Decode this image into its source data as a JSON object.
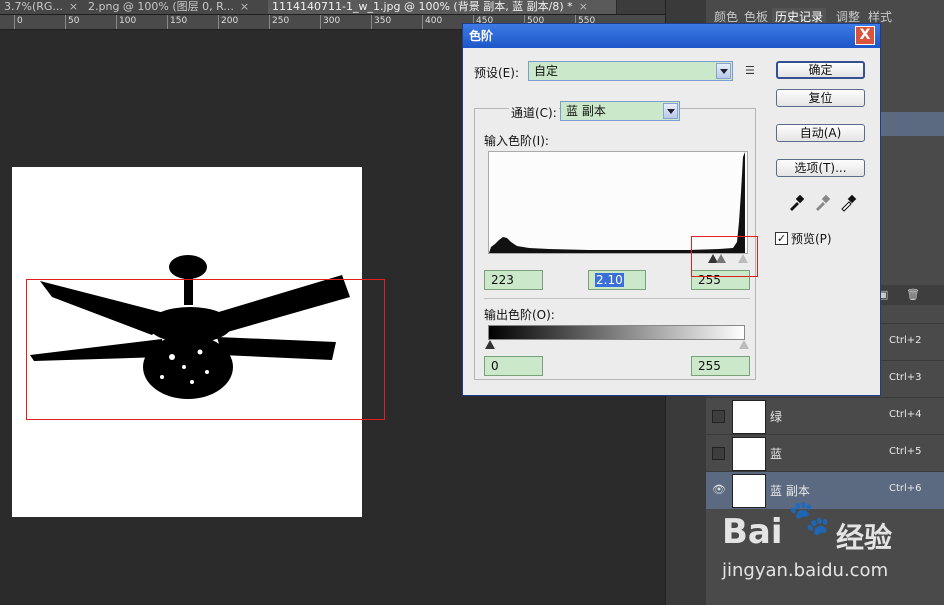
{
  "tabs": [
    {
      "label": "3.7%(RG..."
    },
    {
      "label": "2.png @ 100% (图层 0, R..."
    },
    {
      "label": "1114140711-1_w_1.jpg @ 100% (背景 副本, 蓝 副本/8) *"
    }
  ],
  "ruler": {
    "numbers": [
      "0",
      "50",
      "100",
      "150",
      "200",
      "250",
      "300",
      "350",
      "400",
      "450",
      "500",
      "550"
    ]
  },
  "right_panel": {
    "tabs": [
      "颜色",
      "色板",
      "历史记录",
      "调整",
      "样式"
    ],
    "layers": [
      {
        "name": "",
        "shortcut": "Ctrl+2"
      },
      {
        "name": "",
        "shortcut": "Ctrl+3"
      },
      {
        "name": "绿",
        "shortcut": "Ctrl+4"
      },
      {
        "name": "蓝",
        "shortcut": "Ctrl+5"
      },
      {
        "name": "蓝 副本",
        "shortcut": "Ctrl+6"
      }
    ]
  },
  "dialog": {
    "title": "色阶",
    "close_label": "X",
    "preset_label": "预设(E):",
    "preset_value": "自定",
    "channel_label": "通道(C):",
    "channel_value": "蓝 副本",
    "input_levels_label": "输入色阶(I):",
    "input_black": "223",
    "input_gamma": "2.10",
    "input_white": "255",
    "output_levels_label": "输出色阶(O):",
    "output_black": "0",
    "output_white": "255",
    "ok_label": "确定",
    "reset_label": "复位",
    "auto_label": "自动(A)",
    "options_label": "选项(T)...",
    "preview_label": "预览(P)",
    "preview_checked": "✓"
  },
  "watermark": {
    "brand": "Bai",
    "brand2": "经验",
    "url": "jingyan.baidu.com"
  }
}
